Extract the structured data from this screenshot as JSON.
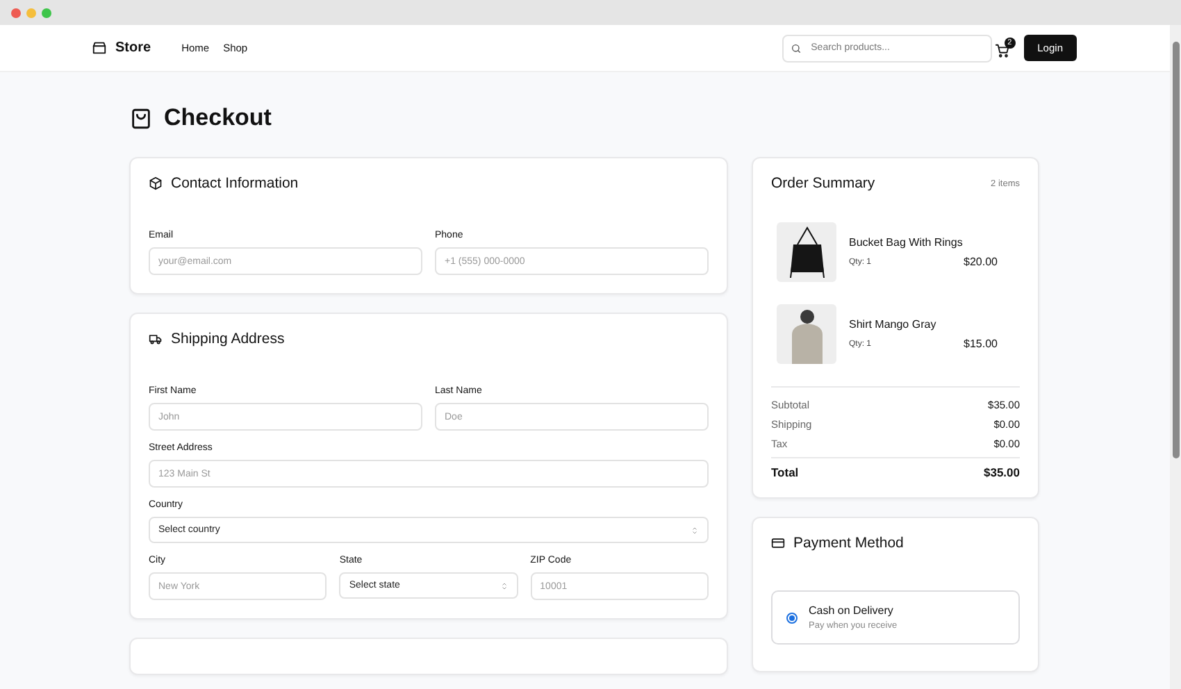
{
  "nav": {
    "brand": "Store",
    "links": [
      {
        "label": "Home"
      },
      {
        "label": "Shop"
      }
    ],
    "search": {
      "placeholder": "Search products..."
    },
    "cart_count": "2",
    "login": "Login"
  },
  "page_title": "Checkout",
  "contact": {
    "title": "Contact Information",
    "rows": [
      [
        {
          "kind": "input",
          "label": "Email",
          "placeholder": "your@email.com"
        },
        {
          "kind": "input",
          "label": "Phone",
          "placeholder": "+1 (555) 000-0000"
        }
      ]
    ]
  },
  "shipping": {
    "title": "Shipping Address",
    "rows": [
      [
        {
          "kind": "input",
          "label": "First Name",
          "placeholder": "John"
        },
        {
          "kind": "input",
          "label": "Last Name",
          "placeholder": "Doe"
        }
      ],
      [
        {
          "kind": "input",
          "label": "Street Address",
          "placeholder": "123 Main St"
        }
      ],
      [
        {
          "kind": "select",
          "label": "Country",
          "value": "Select country"
        }
      ],
      [
        {
          "kind": "input",
          "label": "City",
          "placeholder": "New York"
        },
        {
          "kind": "select",
          "label": "State",
          "value": "Select state"
        },
        {
          "kind": "input",
          "label": "ZIP Code",
          "placeholder": "10001"
        }
      ]
    ]
  },
  "summary": {
    "title": "Order Summary",
    "count": "2 items",
    "items": [
      {
        "kind": "bag",
        "name": "Bucket Bag With Rings",
        "qty": "Qty: 1",
        "price": "$20.00"
      },
      {
        "kind": "shirt",
        "name": "Shirt Mango Gray",
        "qty": "Qty: 1",
        "price": "$15.00"
      }
    ],
    "totals": [
      {
        "kind": "line",
        "label": "Subtotal",
        "value": "$35.00"
      },
      {
        "kind": "line",
        "label": "Shipping",
        "value": "$0.00"
      },
      {
        "kind": "line",
        "label": "Tax",
        "value": "$0.00"
      },
      {
        "kind": "total",
        "label": "Total",
        "value": "$35.00"
      }
    ]
  },
  "payment": {
    "title": "Payment Method",
    "options": [
      {
        "label": "Cash on Delivery",
        "hint": "Pay when you receive",
        "selected": true
      }
    ]
  }
}
